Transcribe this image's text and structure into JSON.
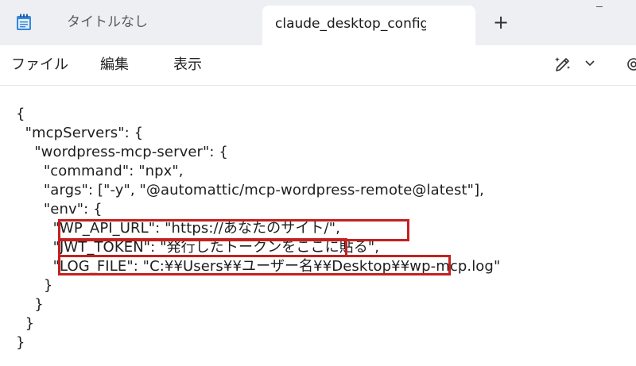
{
  "tabs": [
    {
      "label": "タイトルなし",
      "active": false
    },
    {
      "label": "claude_desktop_config.json",
      "active": true
    }
  ],
  "new_tab_label": "+",
  "menu": {
    "file": "ファイル",
    "edit": "編集",
    "view": "表示"
  },
  "editor": {
    "lines": [
      "{",
      "  \"mcpServers\": {",
      "    \"wordpress-mcp-server\": {",
      "      \"command\": \"npx\",",
      "      \"args\": [\"-y\", \"@automattic/mcp-wordpress-remote@latest\"],",
      "      \"env\": {",
      "        \"WP_API_URL\": \"https://あなたのサイト/\",",
      "        \"JWT_TOKEN\": \"発行したトークンをここに貼る\",",
      "        \"LOG_FILE\": \"C:¥¥Users¥¥ユーザー名¥¥Desktop¥¥wp-mcp.log\"",
      "      }",
      "    }",
      "  }",
      "}"
    ]
  },
  "colors": {
    "tabbar_bg": "#eeeff3",
    "highlight": "#c42020",
    "app_icon": "#3a86d6"
  },
  "icons": {
    "app": "notepad-icon",
    "copilot": "copilot-pen-icon",
    "chevron": "chevron-down-icon",
    "settings": "gear-icon"
  }
}
